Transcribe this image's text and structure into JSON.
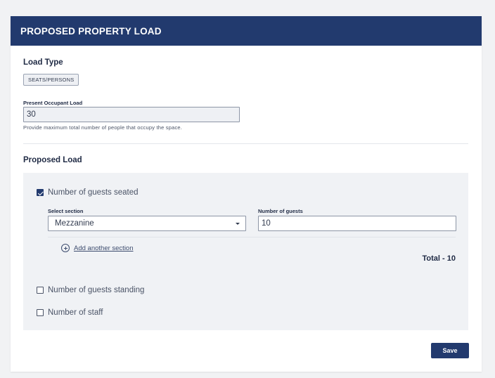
{
  "header": {
    "title": "PROPOSED PROPERTY LOAD"
  },
  "load_type": {
    "title": "Load Type",
    "tag": "SEATS/PERSONS"
  },
  "present_load": {
    "label": "Present Occupant Load",
    "value": "30",
    "helper": "Provide maximum total number of people that occupy the space."
  },
  "proposed_load": {
    "title": "Proposed Load",
    "seated": {
      "label": "Number of guests seated",
      "checked": true,
      "section_label": "Select section",
      "section_value": "Mezzanine",
      "guests_label": "Number of guests",
      "guests_value": "10",
      "add_section": "Add another section",
      "total": "Total - 10"
    },
    "standing": {
      "label": "Number of guests standing",
      "checked": false
    },
    "staff": {
      "label": "Number of staff",
      "checked": false
    }
  },
  "actions": {
    "save_label": "Save"
  },
  "colors": {
    "brand": "#223a6e",
    "panel": "#f0f2f5",
    "background": "#f1f2f4"
  },
  "icons": {
    "checkbox_checked": "check-icon",
    "add": "plus-circle-icon",
    "dropdown": "chevron-down-icon"
  }
}
